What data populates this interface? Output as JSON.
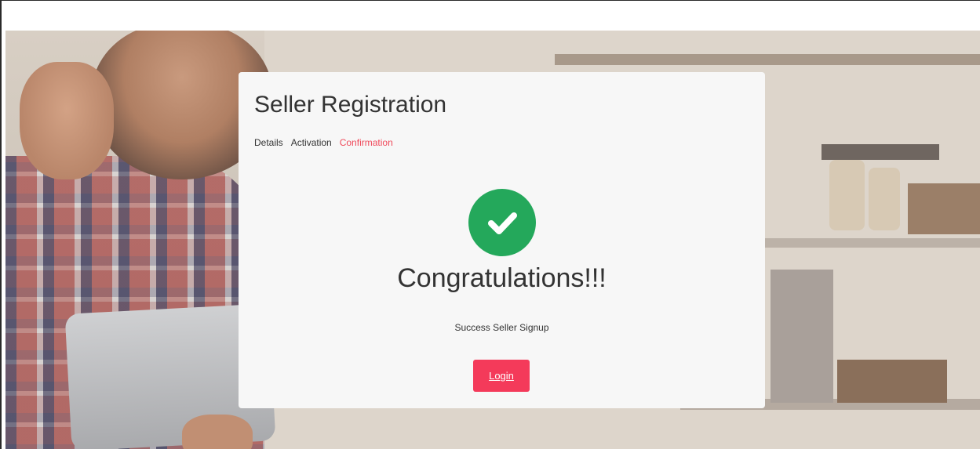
{
  "registration": {
    "title": "Seller Registration",
    "steps": [
      {
        "label": "Details",
        "active": false
      },
      {
        "label": "Activation",
        "active": false
      },
      {
        "label": "Confirmation",
        "active": true
      }
    ],
    "success_icon": "check-circle-icon",
    "heading": "Congratulations!!!",
    "message": "Success Seller Signup",
    "login_label": "Login"
  },
  "colors": {
    "accent": "#f43a5a",
    "success": "#24a85b",
    "card": "#f7f7f7"
  }
}
